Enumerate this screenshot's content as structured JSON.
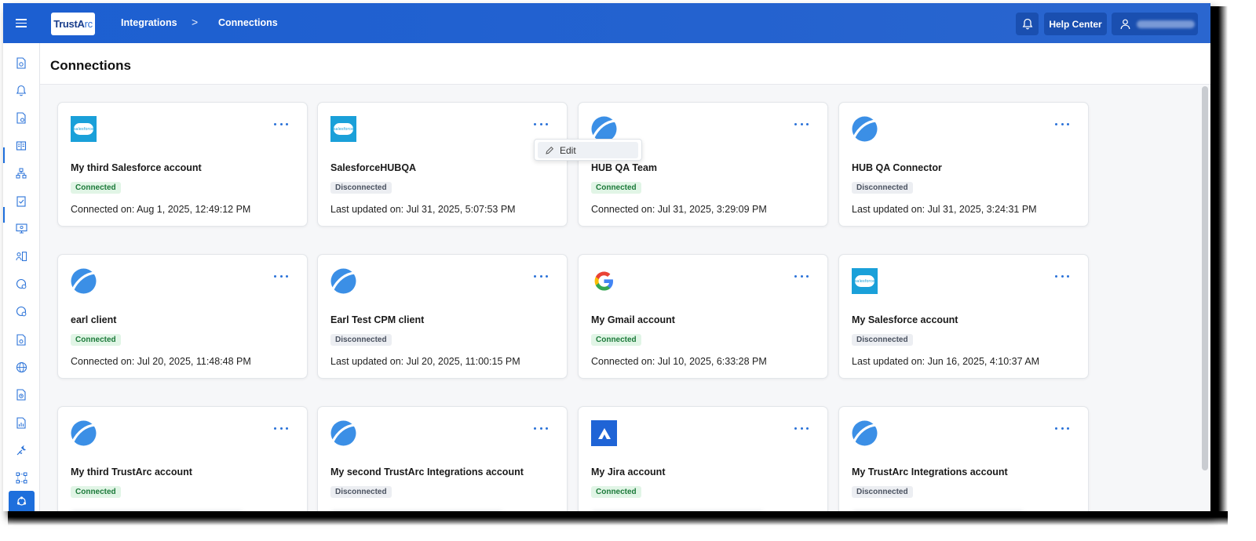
{
  "header": {
    "logo_text_a": "TrustA",
    "logo_text_b": "rc",
    "breadcrumb": [
      "Integrations",
      "Connections"
    ],
    "breadcrumb_sep": ">",
    "help_label": "Help Center"
  },
  "page": {
    "title": "Connections"
  },
  "colors": {
    "topbar": "#1c5fd1",
    "accent": "#2a72d8",
    "connected_bg": "#e1f5e6",
    "connected_fg": "#1c7a3a",
    "disconnected_bg": "#eceef2"
  },
  "menu": {
    "edit_label": "Edit"
  },
  "cards": [
    {
      "logo": "salesforce",
      "name": "My third Salesforce account",
      "status": "Connected",
      "meta": "Connected on: Aug 1, 2025, 12:49:12 PM"
    },
    {
      "logo": "salesforce",
      "name": "SalesforceHUBQA",
      "status": "Disconnected",
      "meta": "Last updated on: Jul 31, 2025, 5:07:53 PM"
    },
    {
      "logo": "trustarc",
      "name": "HUB QA Team",
      "status": "Connected",
      "meta": "Connected on: Jul 31, 2025, 3:29:09 PM"
    },
    {
      "logo": "trustarc",
      "name": "HUB QA Connector",
      "status": "Disconnected",
      "meta": "Last updated on: Jul 31, 2025, 3:24:31 PM"
    },
    {
      "logo": "trustarc",
      "name": "earl client",
      "status": "Connected",
      "meta": "Connected on: Jul 20, 2025, 11:48:48 PM"
    },
    {
      "logo": "trustarc",
      "name": "Earl Test CPM client",
      "status": "Disconnected",
      "meta": "Last updated on: Jul 20, 2025, 11:00:15 PM"
    },
    {
      "logo": "google",
      "name": "My Gmail account",
      "status": "Connected",
      "meta": "Connected on: Jul 10, 2025, 6:33:28 PM"
    },
    {
      "logo": "salesforce",
      "name": "My Salesforce account",
      "status": "Disconnected",
      "meta": "Last updated on: Jun 16, 2025, 4:10:37 AM"
    },
    {
      "logo": "trustarc",
      "name": "My third TrustArc account",
      "status": "Connected",
      "meta": ""
    },
    {
      "logo": "trustarc",
      "name": "My second TrustArc Integrations account",
      "status": "Disconnected",
      "meta": ""
    },
    {
      "logo": "jira",
      "name": "My Jira account",
      "status": "Connected",
      "meta": ""
    },
    {
      "logo": "trustarc",
      "name": "My TrustArc Integrations account",
      "status": "Disconnected",
      "meta": ""
    }
  ],
  "sidebar_icons": [
    "report-icon",
    "bell-icon",
    "document-icon",
    "book-icon",
    "network-icon",
    "clipboard-check-icon",
    "monitor-icon",
    "person-list-icon",
    "globe-gear-icon",
    "globe-gear-alt-icon",
    "document-settings-icon",
    "globe-icon",
    "document-clock-icon",
    "chart-doc-icon",
    "tools-icon",
    "workflow-icon",
    "integrations-icon"
  ]
}
